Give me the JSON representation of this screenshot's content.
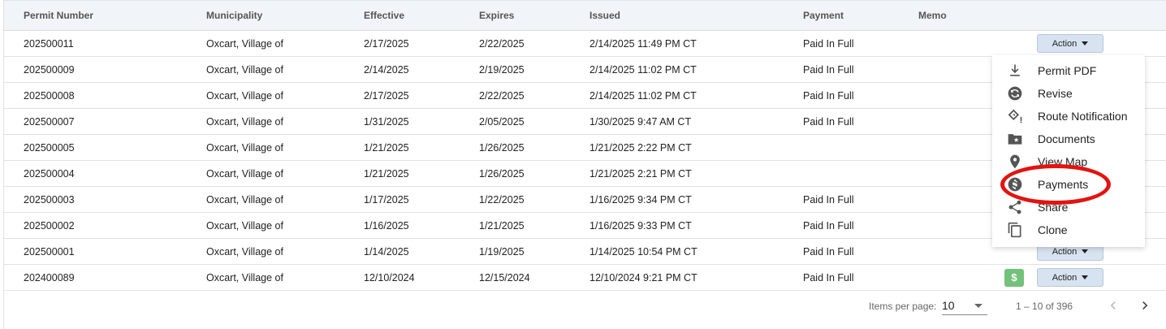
{
  "table": {
    "headers": {
      "permit_number": "Permit Number",
      "municipality": "Municipality",
      "effective": "Effective",
      "expires": "Expires",
      "issued": "Issued",
      "payment": "Payment",
      "memo": "Memo"
    },
    "rows": [
      {
        "permit": "202500011",
        "municipality": "Oxcart, Village of",
        "effective": "2/17/2025",
        "expires": "2/22/2025",
        "issued": "2/14/2025 11:49 PM CT",
        "payment": "Paid In Full",
        "memo": ""
      },
      {
        "permit": "202500009",
        "municipality": "Oxcart, Village of",
        "effective": "2/14/2025",
        "expires": "2/19/2025",
        "issued": "2/14/2025 11:02 PM CT",
        "payment": "Paid In Full",
        "memo": ""
      },
      {
        "permit": "202500008",
        "municipality": "Oxcart, Village of",
        "effective": "2/17/2025",
        "expires": "2/22/2025",
        "issued": "2/14/2025 11:02 PM CT",
        "payment": "Paid In Full",
        "memo": ""
      },
      {
        "permit": "202500007",
        "municipality": "Oxcart, Village of",
        "effective": "1/31/2025",
        "expires": "2/05/2025",
        "issued": "1/30/2025 9:47 AM CT",
        "payment": "Paid In Full",
        "memo": ""
      },
      {
        "permit": "202500005",
        "municipality": "Oxcart, Village of",
        "effective": "1/21/2025",
        "expires": "1/26/2025",
        "issued": "1/21/2025 2:22 PM CT",
        "payment": "",
        "memo": ""
      },
      {
        "permit": "202500004",
        "municipality": "Oxcart, Village of",
        "effective": "1/21/2025",
        "expires": "1/26/2025",
        "issued": "1/21/2025 2:21 PM CT",
        "payment": "",
        "memo": ""
      },
      {
        "permit": "202500003",
        "municipality": "Oxcart, Village of",
        "effective": "1/17/2025",
        "expires": "1/22/2025",
        "issued": "1/16/2025 9:34 PM CT",
        "payment": "Paid In Full",
        "memo": ""
      },
      {
        "permit": "202500002",
        "municipality": "Oxcart, Village of",
        "effective": "1/16/2025",
        "expires": "1/21/2025",
        "issued": "1/16/2025 9:33 PM CT",
        "payment": "Paid In Full",
        "memo": ""
      },
      {
        "permit": "202500001",
        "municipality": "Oxcart, Village of",
        "effective": "1/14/2025",
        "expires": "1/19/2025",
        "issued": "1/14/2025 10:54 PM CT",
        "payment": "Paid In Full",
        "memo": ""
      },
      {
        "permit": "202400089",
        "municipality": "Oxcart, Village of",
        "effective": "12/10/2024",
        "expires": "12/15/2024",
        "issued": "12/10/2024 9:21 PM CT",
        "payment": "Paid In Full",
        "memo": ""
      }
    ],
    "action_label": "Action",
    "payment_badge_glyph": "$"
  },
  "menu": {
    "items": [
      {
        "label": "Permit PDF",
        "icon": "download-icon"
      },
      {
        "label": "Revise",
        "icon": "revise-icon"
      },
      {
        "label": "Route Notification",
        "icon": "route-notification-icon"
      },
      {
        "label": "Documents",
        "icon": "folder-star-icon"
      },
      {
        "label": "View Map",
        "icon": "map-pin-icon"
      },
      {
        "label": "Payments",
        "icon": "dollar-circle-icon"
      },
      {
        "label": "Share",
        "icon": "share-icon"
      },
      {
        "label": "Clone",
        "icon": "copy-icon"
      }
    ]
  },
  "paginator": {
    "items_per_page_label": "Items per page:",
    "page_size": "10",
    "range": "1 – 10 of 396"
  },
  "colors": {
    "header_bg": "#f1f5fa",
    "action_button_bg": "#d7e3f1",
    "payment_badge": "#72c27b",
    "highlight": "#e3130f"
  }
}
